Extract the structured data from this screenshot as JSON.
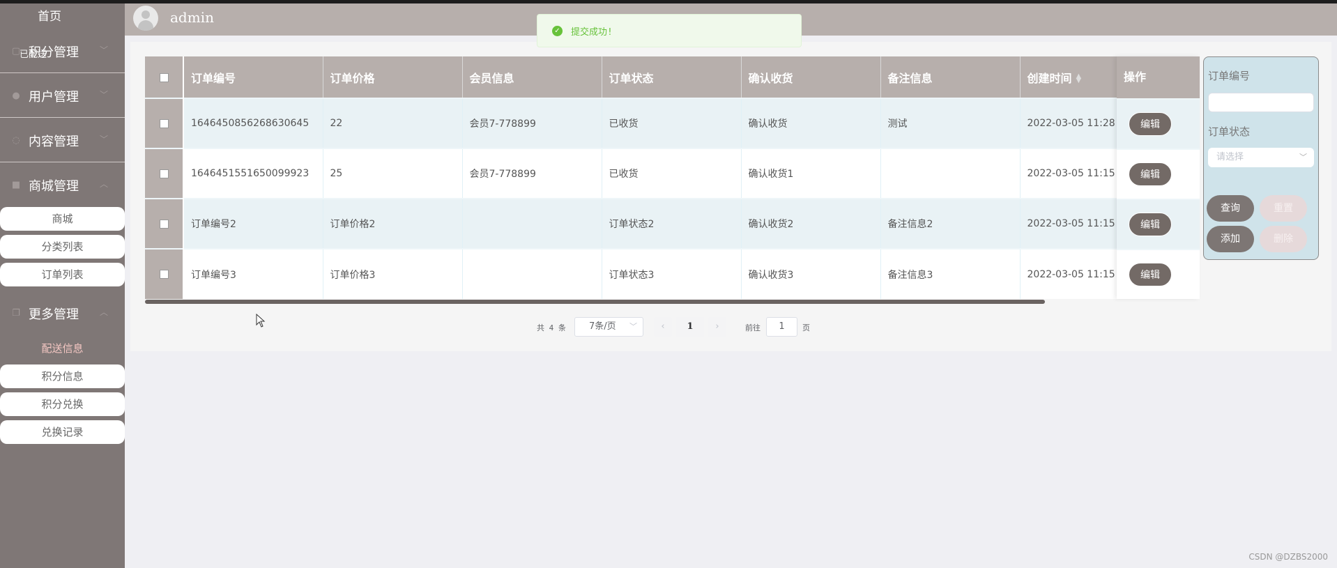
{
  "sidebar": {
    "home": "首页",
    "overlap_label": "已配送",
    "groups": [
      {
        "label": "积分管理",
        "icon": "lock-icon"
      },
      {
        "label": "用户管理",
        "icon": "person-icon"
      },
      {
        "label": "内容管理",
        "icon": "chat-icon"
      },
      {
        "label": "商城管理",
        "icon": "bag-icon"
      },
      {
        "label": "更多管理",
        "icon": "copy-icon"
      }
    ],
    "mall_items": [
      "商城",
      "分类列表",
      "订单列表"
    ],
    "more_items": [
      "配送信息",
      "积分信息",
      "积分兑换",
      "兑换记录"
    ]
  },
  "header": {
    "username": "admin"
  },
  "toast": {
    "text": "提交成功!",
    "color": "#67c23a"
  },
  "table": {
    "headers": [
      "订单编号",
      "订单价格",
      "会员信息",
      "订单状态",
      "确认收货",
      "备注信息",
      "创建时间",
      "操作"
    ],
    "rows": [
      [
        "1646450856268630645",
        "22",
        "会员7-778899",
        "已收货",
        "确认收货",
        "测试",
        "2022-03-05 11:28"
      ],
      [
        "1646451551650099923",
        "25",
        "会员7-778899",
        "已收货",
        "确认收货1",
        "",
        "2022-03-05 11:15"
      ],
      [
        "订单编号2",
        "订单价格2",
        "",
        "订单状态2",
        "确认收货2",
        "备注信息2",
        "2022-03-05 11:15"
      ],
      [
        "订单编号3",
        "订单价格3",
        "",
        "订单状态3",
        "确认收货3",
        "备注信息3",
        "2022-03-05 11:15"
      ]
    ],
    "edit_label": "编辑"
  },
  "pagination": {
    "total": "共 4 条",
    "page_size": "7条/页",
    "current_page": "1",
    "goto_prefix": "前往",
    "goto_value": "1",
    "goto_suffix": "页"
  },
  "search": {
    "order_no_label": "订单编号",
    "status_label": "订单状态",
    "status_placeholder": "请选择",
    "query": "查询",
    "reset": "重置",
    "add": "添加",
    "delete": "删除"
  },
  "watermark": "CSDN @DZBS2000",
  "colors": {
    "sidebar": "#7f7776",
    "header": "#b7afac",
    "accent_button": "#736a66",
    "search_panel": "#cfe3ea"
  }
}
